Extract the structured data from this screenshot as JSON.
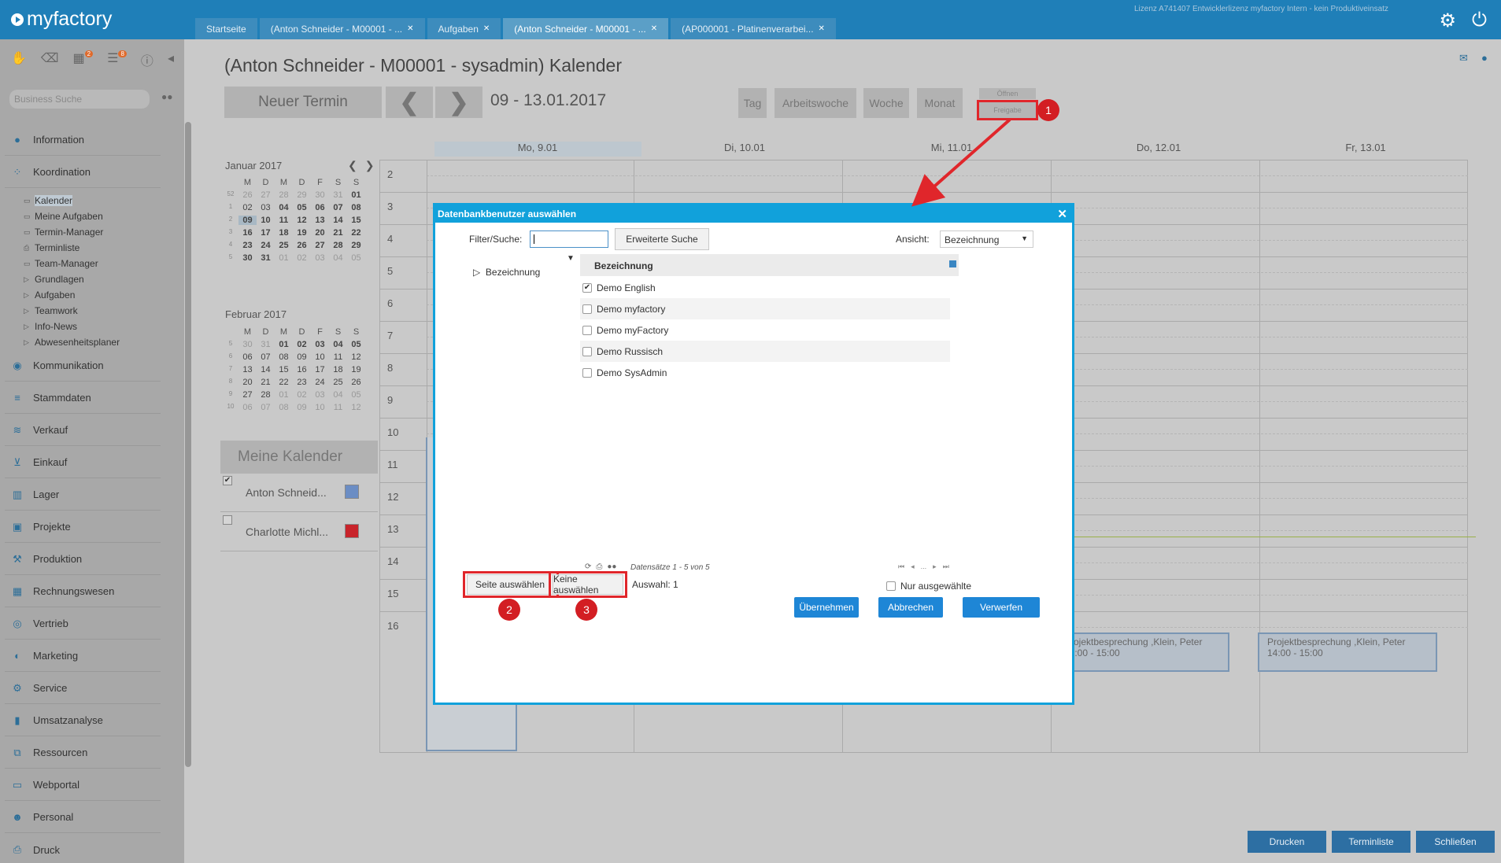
{
  "topbar": {
    "app_name": "myfactory",
    "license": "Lizenz A741407 Entwicklerlizenz myfactory Intern - kein Produktiveinsatz",
    "tabs": [
      {
        "label": "Startseite",
        "closable": false
      },
      {
        "label": "(Anton Schneider - M00001 - ...",
        "closable": true
      },
      {
        "label": "Aufgaben",
        "closable": true
      },
      {
        "label": "(Anton Schneider - M00001 - ...",
        "closable": true,
        "active": true
      },
      {
        "label": "(AP000001 - Platinenverarbei...",
        "closable": true
      }
    ]
  },
  "sidebar": {
    "toolbar_badges": {
      "calendar": "2",
      "tasks": "8"
    },
    "search_placeholder": "Business Suche",
    "nav": [
      {
        "label": "Information",
        "icon": "info-icon"
      },
      {
        "label": "Koordination",
        "icon": "coordination-icon"
      },
      {
        "label": "Kommunikation",
        "icon": "communication-icon"
      },
      {
        "label": "Stammdaten",
        "icon": "database-icon"
      },
      {
        "label": "Verkauf",
        "icon": "sales-icon"
      },
      {
        "label": "Einkauf",
        "icon": "cart-icon"
      },
      {
        "label": "Lager",
        "icon": "warehouse-icon"
      },
      {
        "label": "Projekte",
        "icon": "projects-icon"
      },
      {
        "label": "Produktion",
        "icon": "production-icon"
      },
      {
        "label": "Rechnungswesen",
        "icon": "accounting-icon"
      },
      {
        "label": "Vertrieb",
        "icon": "distribution-icon"
      },
      {
        "label": "Marketing",
        "icon": "marketing-icon"
      },
      {
        "label": "Service",
        "icon": "gear-icon"
      },
      {
        "label": "Umsatzanalyse",
        "icon": "chart-icon"
      },
      {
        "label": "Ressourcen",
        "icon": "resources-icon"
      },
      {
        "label": "Webportal",
        "icon": "webportal-icon"
      },
      {
        "label": "Personal",
        "icon": "people-icon"
      },
      {
        "label": "Druck",
        "icon": "printer-icon"
      }
    ],
    "sub": [
      {
        "label": "Kalender",
        "icon": "calendar-icon"
      },
      {
        "label": "Meine Aufgaben",
        "icon": "calendar-icon"
      },
      {
        "label": "Termin-Manager",
        "icon": "calendar-icon"
      },
      {
        "label": "Terminliste",
        "icon": "printer-icon"
      },
      {
        "label": "Team-Manager",
        "icon": "calendar-icon"
      },
      {
        "label": "Grundlagen",
        "icon": "triangle-right-icon"
      },
      {
        "label": "Aufgaben",
        "icon": "triangle-right-icon"
      },
      {
        "label": "Teamwork",
        "icon": "triangle-right-icon"
      },
      {
        "label": "Info-News",
        "icon": "triangle-right-icon"
      },
      {
        "label": "Abwesenheitsplaner",
        "icon": "triangle-right-icon"
      }
    ]
  },
  "header": {
    "title": "(Anton Schneider - M00001 - sysadmin) Kalender",
    "new_button": "Neuer Termin",
    "date_range": "09 - 13.01.2017",
    "views": [
      "Tag",
      "Arbeitswoche",
      "Woche",
      "Monat"
    ],
    "oeffnen": "Öffnen",
    "freigabe": "Freigabe"
  },
  "mini_cal": {
    "jan_title": "Januar 2017",
    "feb_title": "Februar 2017",
    "weekdays": [
      "M",
      "D",
      "M",
      "D",
      "F",
      "S",
      "S"
    ],
    "jan_weeks": [
      [
        "52",
        "26",
        "27",
        "28",
        "29",
        "30",
        "31",
        "01"
      ],
      [
        "1",
        "02",
        "03",
        "04",
        "05",
        "06",
        "07",
        "08"
      ],
      [
        "2",
        "09",
        "10",
        "11",
        "12",
        "13",
        "14",
        "15"
      ],
      [
        "3",
        "16",
        "17",
        "18",
        "19",
        "20",
        "21",
        "22"
      ],
      [
        "4",
        "23",
        "24",
        "25",
        "26",
        "27",
        "28",
        "29"
      ],
      [
        "5",
        "30",
        "31",
        "01",
        "02",
        "03",
        "04",
        "05"
      ]
    ],
    "feb_weeks": [
      [
        "5",
        "30",
        "31",
        "01",
        "02",
        "03",
        "04",
        "05"
      ],
      [
        "6",
        "06",
        "07",
        "08",
        "09",
        "10",
        "11",
        "12"
      ],
      [
        "7",
        "13",
        "14",
        "15",
        "16",
        "17",
        "18",
        "19"
      ],
      [
        "8",
        "20",
        "21",
        "22",
        "23",
        "24",
        "25",
        "26"
      ],
      [
        "9",
        "27",
        "28",
        "01",
        "02",
        "03",
        "04",
        "05"
      ],
      [
        "10",
        "06",
        "07",
        "08",
        "09",
        "10",
        "11",
        "12"
      ]
    ]
  },
  "my_calendars": {
    "title": "Meine Kalender",
    "items": [
      {
        "name": "Anton Schneid...",
        "checked": true,
        "color": "#6b8dc4"
      },
      {
        "name": "Charlotte Michl...",
        "checked": false,
        "color": "#c8242b"
      }
    ]
  },
  "week": {
    "days": [
      "Mo, 9.01",
      "Di, 10.01",
      "Mi, 11.01",
      "Do, 12.01",
      "Fr, 13.01"
    ],
    "hours": [
      "2",
      "3",
      "4",
      "5",
      "6",
      "7",
      "8",
      "9",
      "10",
      "11",
      "12",
      "13",
      "14",
      "15",
      "16"
    ],
    "events": [
      {
        "title": "Projektbesprechung ,Klein, Peter",
        "time": "14:00 - 15:00",
        "day": "Do, 12.01"
      },
      {
        "title": "Projektbesprechung ,Klein, Peter",
        "time": "14:00 - 15:00",
        "day": "Fr, 13.01"
      }
    ]
  },
  "footer": {
    "drucken": "Drucken",
    "terminliste": "Terminliste",
    "schliessen": "Schließen"
  },
  "dialog": {
    "title": "Datenbankbenutzer auswählen",
    "filter_label": "Filter/Suche:",
    "filter_value": "",
    "advanced_search": "Erweiterte Suche",
    "view_label": "Ansicht:",
    "view_value": "Bezeichnung",
    "tree_item": "Bezeichnung",
    "column_header": "Bezeichnung",
    "rows": [
      {
        "label": "Demo English",
        "checked": true
      },
      {
        "label": "Demo myfactory",
        "checked": false
      },
      {
        "label": "Demo myFactory",
        "checked": false
      },
      {
        "label": "Demo Russisch",
        "checked": false
      },
      {
        "label": "Demo SysAdmin",
        "checked": false
      }
    ],
    "records_info": "Datensätze 1 - 5 von 5",
    "pager_ellipsis": "...",
    "select_page": "Seite auswählen",
    "select_none": "Keine auswählen",
    "selection": "Auswahl: 1",
    "only_selected": "Nur ausgewählte",
    "apply": "Übernehmen",
    "cancel": "Abbrechen",
    "discard": "Verwerfen"
  },
  "annotations": {
    "n1": "1",
    "n2": "2",
    "n3": "3"
  },
  "colors": {
    "accent": "#11a1db",
    "topbar": "#1f7fb8",
    "annotation": "#e0262b",
    "primary_button": "#1e86d6"
  }
}
